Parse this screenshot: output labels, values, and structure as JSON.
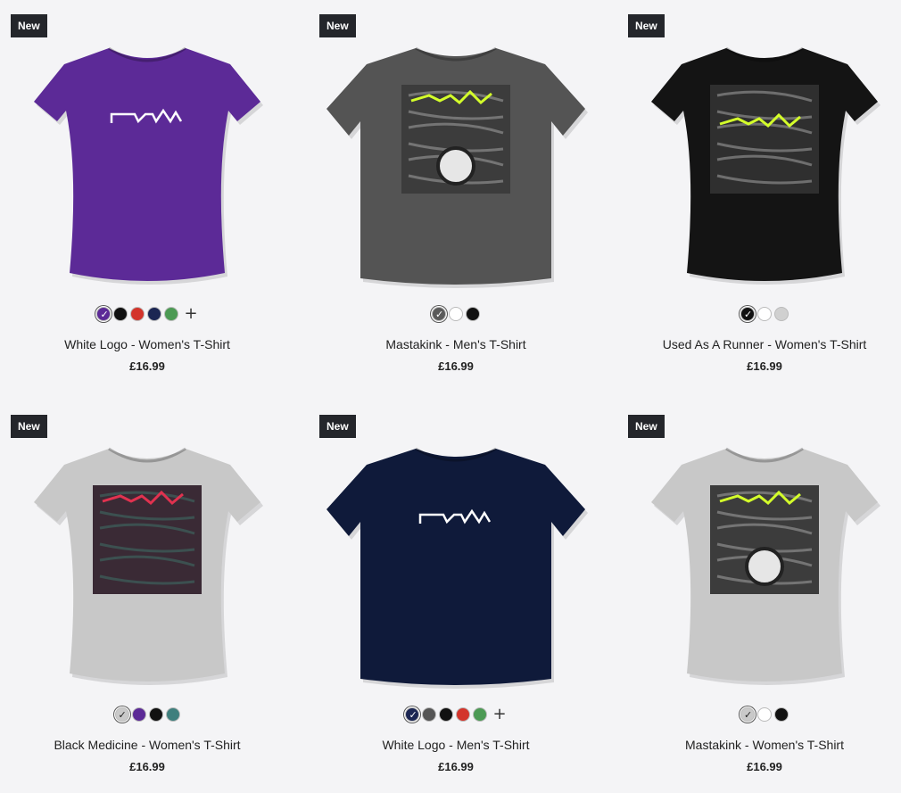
{
  "products": [
    {
      "badge": "New",
      "title": "White Logo - Women's T-Shirt",
      "price": "£16.99",
      "shirt_color": "#5c2a97",
      "shirt_type": "women",
      "print": "logo",
      "swatches": [
        "#5c2a97",
        "#111111",
        "#d3342b",
        "#1b2653",
        "#4c9a54"
      ],
      "selected": 0,
      "more": "+"
    },
    {
      "badge": "New",
      "title": "Mastakink - Men's T-Shirt",
      "price": "£16.99",
      "shirt_color": "#545454",
      "shirt_type": "men",
      "print": "turntable",
      "swatches": [
        "#5a5a5a",
        "#ffffff",
        "#111111"
      ],
      "selected": 0,
      "more": ""
    },
    {
      "badge": "New",
      "title": "Used As A Runner - Women's T-Shirt",
      "price": "£16.99",
      "shirt_color": "#141414",
      "shirt_type": "women",
      "print": "runner",
      "swatches": [
        "#111111",
        "#ffffff",
        "#d0d0d0"
      ],
      "selected": 0,
      "more": ""
    },
    {
      "badge": "New",
      "title": "Black Medicine - Women's T-Shirt",
      "price": "£16.99",
      "shirt_color": "#c8c8c8",
      "shirt_type": "women",
      "print": "medicine",
      "swatches": [
        "#c9c9c9",
        "#5c2a97",
        "#111111",
        "#3f7f7d"
      ],
      "selected": 0,
      "more": ""
    },
    {
      "badge": "New",
      "title": "White Logo - Men's T-Shirt",
      "price": "£16.99",
      "shirt_color": "#0f1a3a",
      "shirt_type": "men",
      "print": "logo",
      "swatches": [
        "#1b2653",
        "#555555",
        "#111111",
        "#d3342b",
        "#4c9a54"
      ],
      "selected": 0,
      "more": "+"
    },
    {
      "badge": "New",
      "title": "Mastakink - Women's T-Shirt",
      "price": "£16.99",
      "shirt_color": "#c8c8c8",
      "shirt_type": "women",
      "print": "turntable",
      "swatches": [
        "#c9c9c9",
        "#ffffff",
        "#111111"
      ],
      "selected": 0,
      "more": ""
    }
  ]
}
